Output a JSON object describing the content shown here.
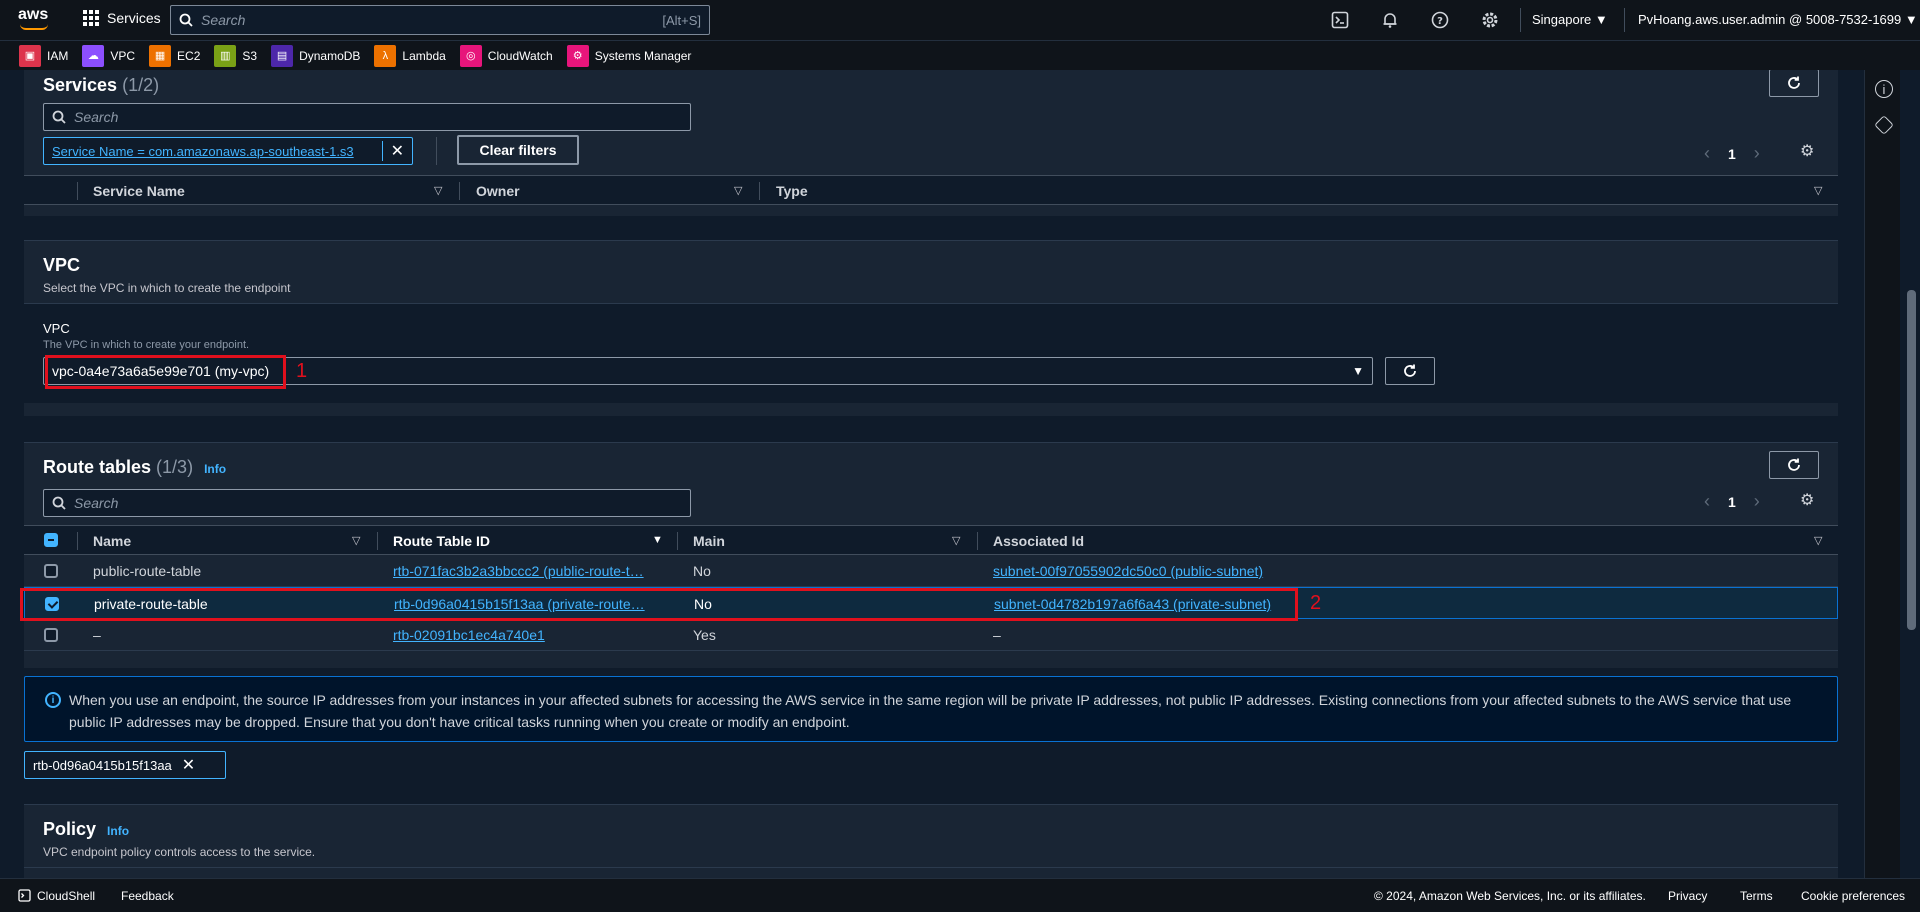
{
  "topnav": {
    "logo": "aws",
    "services_label": "Services",
    "search_placeholder": "Search",
    "search_shortcut": "[Alt+S]",
    "region": "Singapore ▼",
    "account": "PvHoang.aws.user.admin @ 5008-7532-1699 ▼",
    "icons": [
      "cloudshell-icon",
      "notifications-icon",
      "help-icon",
      "settings-icon"
    ]
  },
  "favorites": [
    {
      "label": "IAM",
      "color": "#dd344c",
      "glyph": "▣"
    },
    {
      "label": "VPC",
      "color": "#8c4fff",
      "glyph": "☁"
    },
    {
      "label": "EC2",
      "color": "#ed7100",
      "glyph": "▦"
    },
    {
      "label": "S3",
      "color": "#7aa116",
      "glyph": "▥"
    },
    {
      "label": "DynamoDB",
      "color": "#4d27aa",
      "glyph": "▤"
    },
    {
      "label": "Lambda",
      "color": "#ed7100",
      "glyph": "λ"
    },
    {
      "label": "CloudWatch",
      "color": "#e7157b",
      "glyph": "◎"
    },
    {
      "label": "Systems Manager",
      "color": "#e7157b",
      "glyph": "⚙"
    }
  ],
  "services_panel": {
    "title": "Services",
    "count": "(1/2)",
    "search_placeholder": "Search",
    "filter_token": "Service Name = com.amazonaws.ap-southeast-1.s3",
    "clear_filters": "Clear filters",
    "page": "1",
    "columns": [
      "Service Name",
      "Owner",
      "Type"
    ]
  },
  "vpc_panel": {
    "title": "VPC",
    "description": "Select the VPC in which to create the endpoint",
    "field_label": "VPC",
    "field_desc": "The VPC in which to create your endpoint.",
    "selected_vpc": "vpc-0a4e73a6a5e99e701 (my-vpc)",
    "callout": "1"
  },
  "route_panel": {
    "title": "Route tables",
    "count": "(1/3)",
    "info": "Info",
    "search_placeholder": "Search",
    "page": "1",
    "columns": [
      "Name",
      "Route Table ID",
      "Main",
      "Associated Id"
    ],
    "rows": [
      {
        "name": "public-route-table",
        "id": "rtb-071fac3b2a3bbccc2 (public-route-t…",
        "main": "No",
        "assoc": "subnet-00f97055902dc50c0 (public-subnet)",
        "checked": false
      },
      {
        "name": "private-route-table",
        "id": "rtb-0d96a0415b15f13aa (private-route…",
        "main": "No",
        "assoc": "subnet-0d4782b197a6f6a43 (private-subnet)",
        "checked": true
      },
      {
        "name": "–",
        "id": "rtb-02091bc1ec4a740e1",
        "main": "Yes",
        "assoc": "–",
        "checked": false
      }
    ],
    "callout": "2"
  },
  "alert": {
    "text": "When you use an endpoint, the source IP addresses from your instances in your affected subnets for accessing the AWS service in the same region will be private IP addresses, not public IP addresses. Existing connections from your affected subnets to the AWS service that use public IP addresses may be dropped. Ensure that you don't have critical tasks running when you create or modify an endpoint."
  },
  "selected_token": "rtb-0d96a0415b15f13aa",
  "policy_panel": {
    "title": "Policy",
    "info": "Info",
    "description": "VPC endpoint policy controls access to the service."
  },
  "footer": {
    "cloudshell": "CloudShell",
    "feedback": "Feedback",
    "copyright": "© 2024, Amazon Web Services, Inc. or its affiliates.",
    "privacy": "Privacy",
    "terms": "Terms",
    "cookies": "Cookie preferences"
  }
}
